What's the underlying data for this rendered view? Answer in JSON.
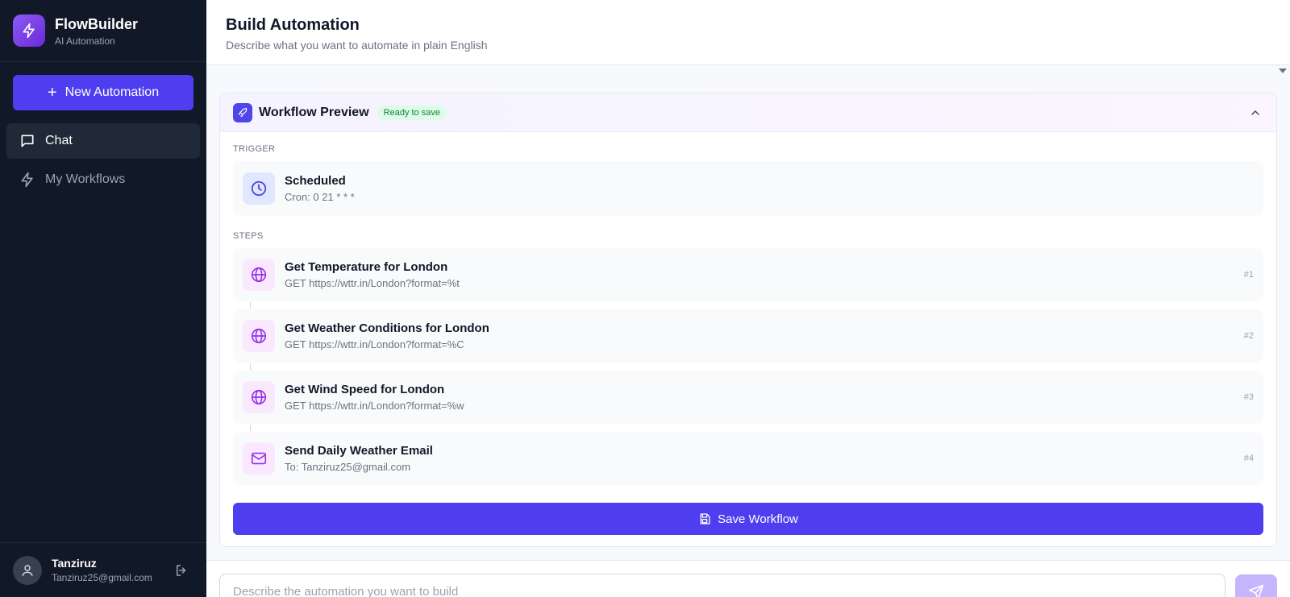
{
  "brand": {
    "name": "FlowBuilder",
    "subtitle": "AI Automation",
    "logo_icon": "lightning-icon"
  },
  "sidebar": {
    "new_button_label": "New Automation",
    "items": [
      {
        "label": "Chat",
        "icon": "chat-icon",
        "active": true
      },
      {
        "label": "My Workflows",
        "icon": "lightning-icon",
        "active": false
      }
    ]
  },
  "user": {
    "name": "Tanziruz",
    "email": "Tanziruz25@gmail.com"
  },
  "header": {
    "title": "Build Automation",
    "subtitle": "Describe what you want to automate in plain English"
  },
  "preview": {
    "title": "Workflow Preview",
    "badge": "Ready to save",
    "trigger_label": "TRIGGER",
    "trigger": {
      "title": "Scheduled",
      "detail": "Cron: 0 21 * * *",
      "icon": "clock-icon"
    },
    "steps_label": "STEPS",
    "steps": [
      {
        "title": "Get Temperature for London",
        "detail": "GET https://wttr.in/London?format=%t",
        "num": "#1",
        "icon": "globe-icon"
      },
      {
        "title": "Get Weather Conditions for London",
        "detail": "GET https://wttr.in/London?format=%C",
        "num": "#2",
        "icon": "globe-icon"
      },
      {
        "title": "Get Wind Speed for London",
        "detail": "GET https://wttr.in/London?format=%w",
        "num": "#3",
        "icon": "globe-icon"
      },
      {
        "title": "Send Daily Weather Email",
        "detail": "To: Tanziruz25@gmail.com",
        "num": "#4",
        "icon": "mail-icon"
      }
    ],
    "save_label": "Save Workflow"
  },
  "chat": {
    "placeholder": "Describe the automation you want to build",
    "value": ""
  },
  "colors": {
    "accent": "#4f3ef0",
    "sidebar_bg": "#111827",
    "badge_bg": "#dcfce7",
    "badge_text": "#15803d"
  }
}
